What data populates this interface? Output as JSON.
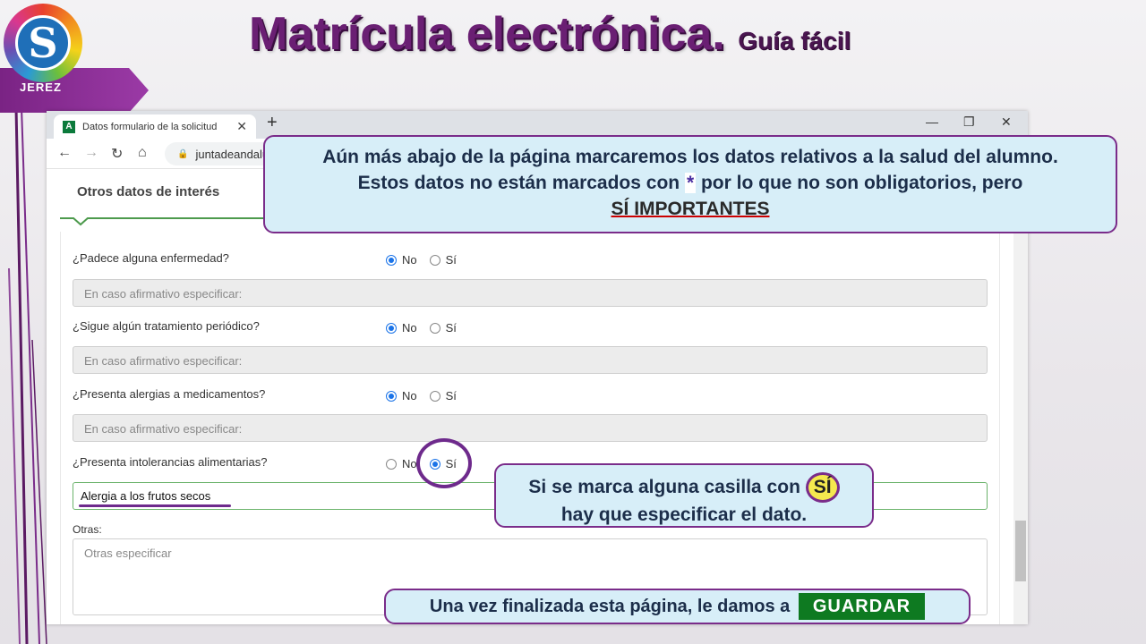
{
  "slide": {
    "title": "Matrícula electrónica.",
    "subtitle": "Guía fácil",
    "logo_letter": "S",
    "logo_caption": "JEREZ"
  },
  "browser": {
    "tab_title": "Datos formulario de la solicitud",
    "tab_favicon": "A",
    "address": "juntadeandalu",
    "icons": [
      "back-icon",
      "forward-icon",
      "reload-icon",
      "home-icon",
      "lock-icon",
      "close-icon",
      "plus-icon",
      "minimize-icon",
      "restore-icon"
    ]
  },
  "form": {
    "section_title": "Otros datos de interés",
    "radio_no": "No",
    "radio_si": "Sí",
    "questions": [
      {
        "label": "¿Padece alguna enfermedad?",
        "selected": "No",
        "detail_placeholder": "En caso afirmativo especificar:",
        "detail_value": ""
      },
      {
        "label": "¿Sigue algún tratamiento periódico?",
        "selected": "No",
        "detail_placeholder": "En caso afirmativo especificar:",
        "detail_value": ""
      },
      {
        "label": "¿Presenta alergias a medicamentos?",
        "selected": "No",
        "detail_placeholder": "En caso afirmativo especificar:",
        "detail_value": ""
      },
      {
        "label": "¿Presenta intolerancias alimentarias?",
        "selected": "Sí",
        "detail_placeholder": "",
        "detail_value": "Alergia a los frutos secos"
      }
    ],
    "otras_label": "Otras:",
    "otras_placeholder": "Otras especificar"
  },
  "callouts": {
    "top_line1": "Aún más abajo de la página marcaremos los datos relativos a la salud del alumno.",
    "top_line2_a": "Estos datos no están marcados con",
    "top_star": "*",
    "top_line2_b": "por lo que no son obligatorios, pero",
    "top_line3": "SÍ IMPORTANTES",
    "mid_line1": "Si se marca alguna casilla con",
    "mid_si": "SÍ",
    "mid_line2": "hay que especificar el dato.",
    "bottom_text": "Una vez finalizada esta página, le damos a",
    "bottom_button": "GUARDAR"
  },
  "colors": {
    "accent_purple": "#7a2c8a",
    "callout_bg": "#d7eef8",
    "guardar_green": "#0e7a21",
    "section_green": "#4d9a4d"
  }
}
